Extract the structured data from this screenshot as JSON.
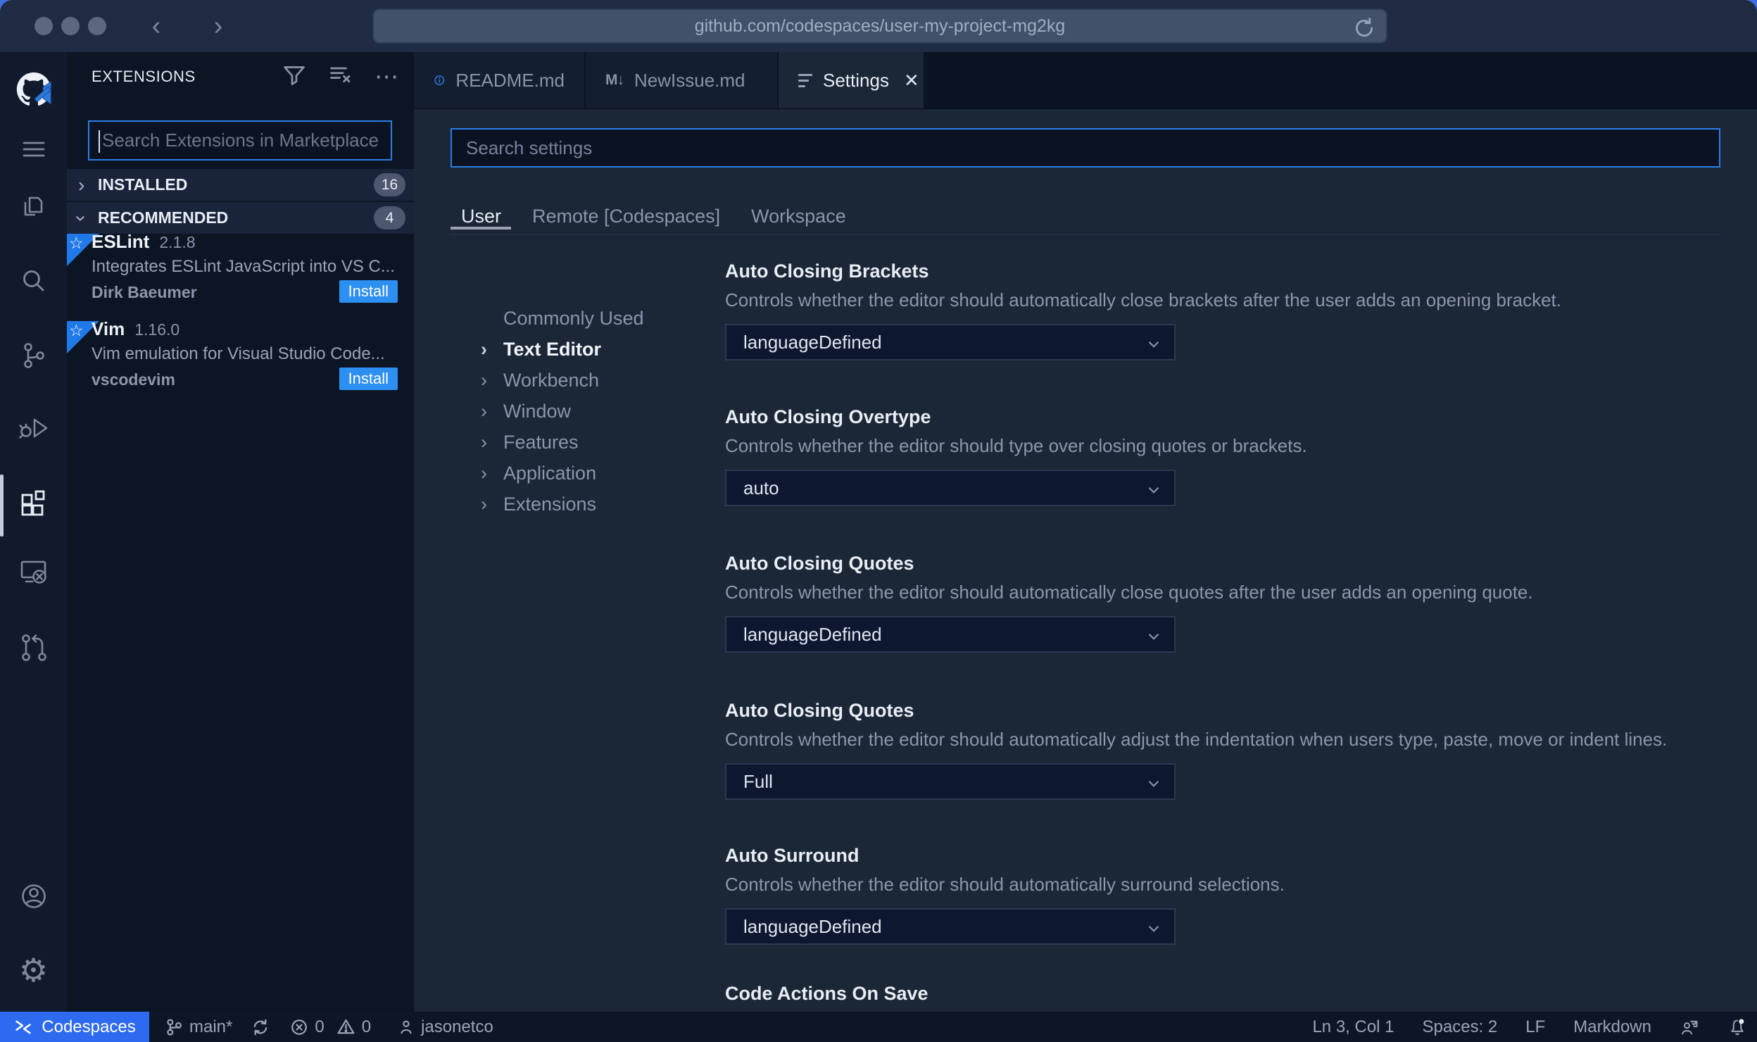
{
  "browser": {
    "url": "github.com/codespaces/user-my-project-mg2kg"
  },
  "sidebar": {
    "title": "EXTENSIONS",
    "search_placeholder": "Search Extensions in Marketplace",
    "sections": [
      {
        "label": "INSTALLED",
        "count": "16"
      },
      {
        "label": "RECOMMENDED",
        "count": "4"
      }
    ],
    "extensions": [
      {
        "name": "ESLint",
        "version": "2.1.8",
        "description": "Integrates ESLint JavaScript into VS C...",
        "publisher": "Dirk Baeumer",
        "action": "Install"
      },
      {
        "name": "Vim",
        "version": "1.16.0",
        "description": "Vim emulation for Visual Studio Code...",
        "publisher": "vscodevim",
        "action": "Install"
      }
    ]
  },
  "tabs": [
    {
      "label": "README.md"
    },
    {
      "label": "NewIssue.md"
    },
    {
      "label": "Settings"
    }
  ],
  "settings": {
    "search_placeholder": "Search settings",
    "scopes": [
      "User",
      "Remote [Codespaces]",
      "Workspace"
    ],
    "toc": [
      "Commonly Used",
      "Text Editor",
      "Workbench",
      "Window",
      "Features",
      "Application",
      "Extensions"
    ],
    "items": [
      {
        "title": "Auto Closing Brackets",
        "description": "Controls whether the editor should automatically close brackets after the user adds an opening bracket.",
        "value": "languageDefined"
      },
      {
        "title": "Auto Closing Overtype",
        "description": "Controls whether the editor should type over closing quotes or brackets.",
        "value": "auto"
      },
      {
        "title": "Auto Closing Quotes",
        "description": "Controls whether the editor should automatically close quotes after the user adds an opening quote.",
        "value": "languageDefined"
      },
      {
        "title": "Auto Closing Quotes",
        "description": "Controls whether the editor should automatically adjust the indentation when users type, paste, move or indent lines.",
        "value": "Full"
      },
      {
        "title": "Auto Surround",
        "description": "Controls whether the editor should automatically surround selections.",
        "value": "languageDefined"
      },
      {
        "title": "Code Actions On Save"
      }
    ]
  },
  "status_bar": {
    "left": {
      "codespaces": "Codespaces",
      "branch": "main*",
      "errors": "0",
      "warnings": "0",
      "user": "jasonetco"
    },
    "right": {
      "cursor": "Ln 3, Col 1",
      "spaces": "Spaces: 2",
      "eol": "LF",
      "language": "Markdown"
    }
  },
  "icons": {
    "ellipsis": "⋯",
    "close": "✕",
    "markdown_tab": "M↓",
    "gear": "⚙",
    "chevron": "›",
    "back": "‹",
    "forward": "›",
    "star": "☆"
  },
  "colors": {
    "accent_blue": "#2b7de9",
    "install_blue": "#2e8ff2",
    "codespaces_blue": "#2e6af0",
    "badge_gray": "#4d5870"
  }
}
